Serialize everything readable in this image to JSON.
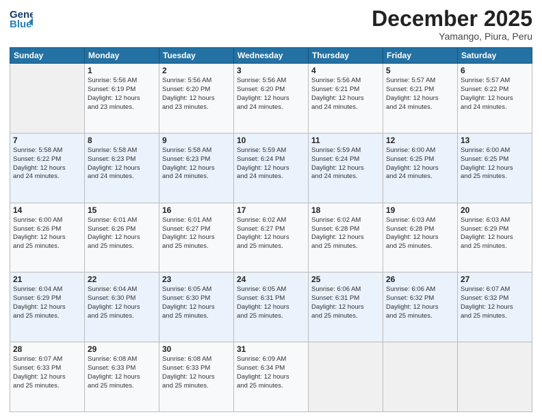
{
  "header": {
    "logo_line1": "General",
    "logo_line2": "Blue",
    "month": "December 2025",
    "location": "Yamango, Piura, Peru"
  },
  "weekdays": [
    "Sunday",
    "Monday",
    "Tuesday",
    "Wednesday",
    "Thursday",
    "Friday",
    "Saturday"
  ],
  "weeks": [
    [
      {
        "day": "",
        "lines": []
      },
      {
        "day": "1",
        "lines": [
          "Sunrise: 5:56 AM",
          "Sunset: 6:19 PM",
          "Daylight: 12 hours",
          "and 23 minutes."
        ]
      },
      {
        "day": "2",
        "lines": [
          "Sunrise: 5:56 AM",
          "Sunset: 6:20 PM",
          "Daylight: 12 hours",
          "and 23 minutes."
        ]
      },
      {
        "day": "3",
        "lines": [
          "Sunrise: 5:56 AM",
          "Sunset: 6:20 PM",
          "Daylight: 12 hours",
          "and 24 minutes."
        ]
      },
      {
        "day": "4",
        "lines": [
          "Sunrise: 5:56 AM",
          "Sunset: 6:21 PM",
          "Daylight: 12 hours",
          "and 24 minutes."
        ]
      },
      {
        "day": "5",
        "lines": [
          "Sunrise: 5:57 AM",
          "Sunset: 6:21 PM",
          "Daylight: 12 hours",
          "and 24 minutes."
        ]
      },
      {
        "day": "6",
        "lines": [
          "Sunrise: 5:57 AM",
          "Sunset: 6:22 PM",
          "Daylight: 12 hours",
          "and 24 minutes."
        ]
      }
    ],
    [
      {
        "day": "7",
        "lines": [
          "Sunrise: 5:58 AM",
          "Sunset: 6:22 PM",
          "Daylight: 12 hours",
          "and 24 minutes."
        ]
      },
      {
        "day": "8",
        "lines": [
          "Sunrise: 5:58 AM",
          "Sunset: 6:23 PM",
          "Daylight: 12 hours",
          "and 24 minutes."
        ]
      },
      {
        "day": "9",
        "lines": [
          "Sunrise: 5:58 AM",
          "Sunset: 6:23 PM",
          "Daylight: 12 hours",
          "and 24 minutes."
        ]
      },
      {
        "day": "10",
        "lines": [
          "Sunrise: 5:59 AM",
          "Sunset: 6:24 PM",
          "Daylight: 12 hours",
          "and 24 minutes."
        ]
      },
      {
        "day": "11",
        "lines": [
          "Sunrise: 5:59 AM",
          "Sunset: 6:24 PM",
          "Daylight: 12 hours",
          "and 24 minutes."
        ]
      },
      {
        "day": "12",
        "lines": [
          "Sunrise: 6:00 AM",
          "Sunset: 6:25 PM",
          "Daylight: 12 hours",
          "and 24 minutes."
        ]
      },
      {
        "day": "13",
        "lines": [
          "Sunrise: 6:00 AM",
          "Sunset: 6:25 PM",
          "Daylight: 12 hours",
          "and 25 minutes."
        ]
      }
    ],
    [
      {
        "day": "14",
        "lines": [
          "Sunrise: 6:00 AM",
          "Sunset: 6:26 PM",
          "Daylight: 12 hours",
          "and 25 minutes."
        ]
      },
      {
        "day": "15",
        "lines": [
          "Sunrise: 6:01 AM",
          "Sunset: 6:26 PM",
          "Daylight: 12 hours",
          "and 25 minutes."
        ]
      },
      {
        "day": "16",
        "lines": [
          "Sunrise: 6:01 AM",
          "Sunset: 6:27 PM",
          "Daylight: 12 hours",
          "and 25 minutes."
        ]
      },
      {
        "day": "17",
        "lines": [
          "Sunrise: 6:02 AM",
          "Sunset: 6:27 PM",
          "Daylight: 12 hours",
          "and 25 minutes."
        ]
      },
      {
        "day": "18",
        "lines": [
          "Sunrise: 6:02 AM",
          "Sunset: 6:28 PM",
          "Daylight: 12 hours",
          "and 25 minutes."
        ]
      },
      {
        "day": "19",
        "lines": [
          "Sunrise: 6:03 AM",
          "Sunset: 6:28 PM",
          "Daylight: 12 hours",
          "and 25 minutes."
        ]
      },
      {
        "day": "20",
        "lines": [
          "Sunrise: 6:03 AM",
          "Sunset: 6:29 PM",
          "Daylight: 12 hours",
          "and 25 minutes."
        ]
      }
    ],
    [
      {
        "day": "21",
        "lines": [
          "Sunrise: 6:04 AM",
          "Sunset: 6:29 PM",
          "Daylight: 12 hours",
          "and 25 minutes."
        ]
      },
      {
        "day": "22",
        "lines": [
          "Sunrise: 6:04 AM",
          "Sunset: 6:30 PM",
          "Daylight: 12 hours",
          "and 25 minutes."
        ]
      },
      {
        "day": "23",
        "lines": [
          "Sunrise: 6:05 AM",
          "Sunset: 6:30 PM",
          "Daylight: 12 hours",
          "and 25 minutes."
        ]
      },
      {
        "day": "24",
        "lines": [
          "Sunrise: 6:05 AM",
          "Sunset: 6:31 PM",
          "Daylight: 12 hours",
          "and 25 minutes."
        ]
      },
      {
        "day": "25",
        "lines": [
          "Sunrise: 6:06 AM",
          "Sunset: 6:31 PM",
          "Daylight: 12 hours",
          "and 25 minutes."
        ]
      },
      {
        "day": "26",
        "lines": [
          "Sunrise: 6:06 AM",
          "Sunset: 6:32 PM",
          "Daylight: 12 hours",
          "and 25 minutes."
        ]
      },
      {
        "day": "27",
        "lines": [
          "Sunrise: 6:07 AM",
          "Sunset: 6:32 PM",
          "Daylight: 12 hours",
          "and 25 minutes."
        ]
      }
    ],
    [
      {
        "day": "28",
        "lines": [
          "Sunrise: 6:07 AM",
          "Sunset: 6:33 PM",
          "Daylight: 12 hours",
          "and 25 minutes."
        ]
      },
      {
        "day": "29",
        "lines": [
          "Sunrise: 6:08 AM",
          "Sunset: 6:33 PM",
          "Daylight: 12 hours",
          "and 25 minutes."
        ]
      },
      {
        "day": "30",
        "lines": [
          "Sunrise: 6:08 AM",
          "Sunset: 6:33 PM",
          "Daylight: 12 hours",
          "and 25 minutes."
        ]
      },
      {
        "day": "31",
        "lines": [
          "Sunrise: 6:09 AM",
          "Sunset: 6:34 PM",
          "Daylight: 12 hours",
          "and 25 minutes."
        ]
      },
      {
        "day": "",
        "lines": []
      },
      {
        "day": "",
        "lines": []
      },
      {
        "day": "",
        "lines": []
      }
    ]
  ]
}
